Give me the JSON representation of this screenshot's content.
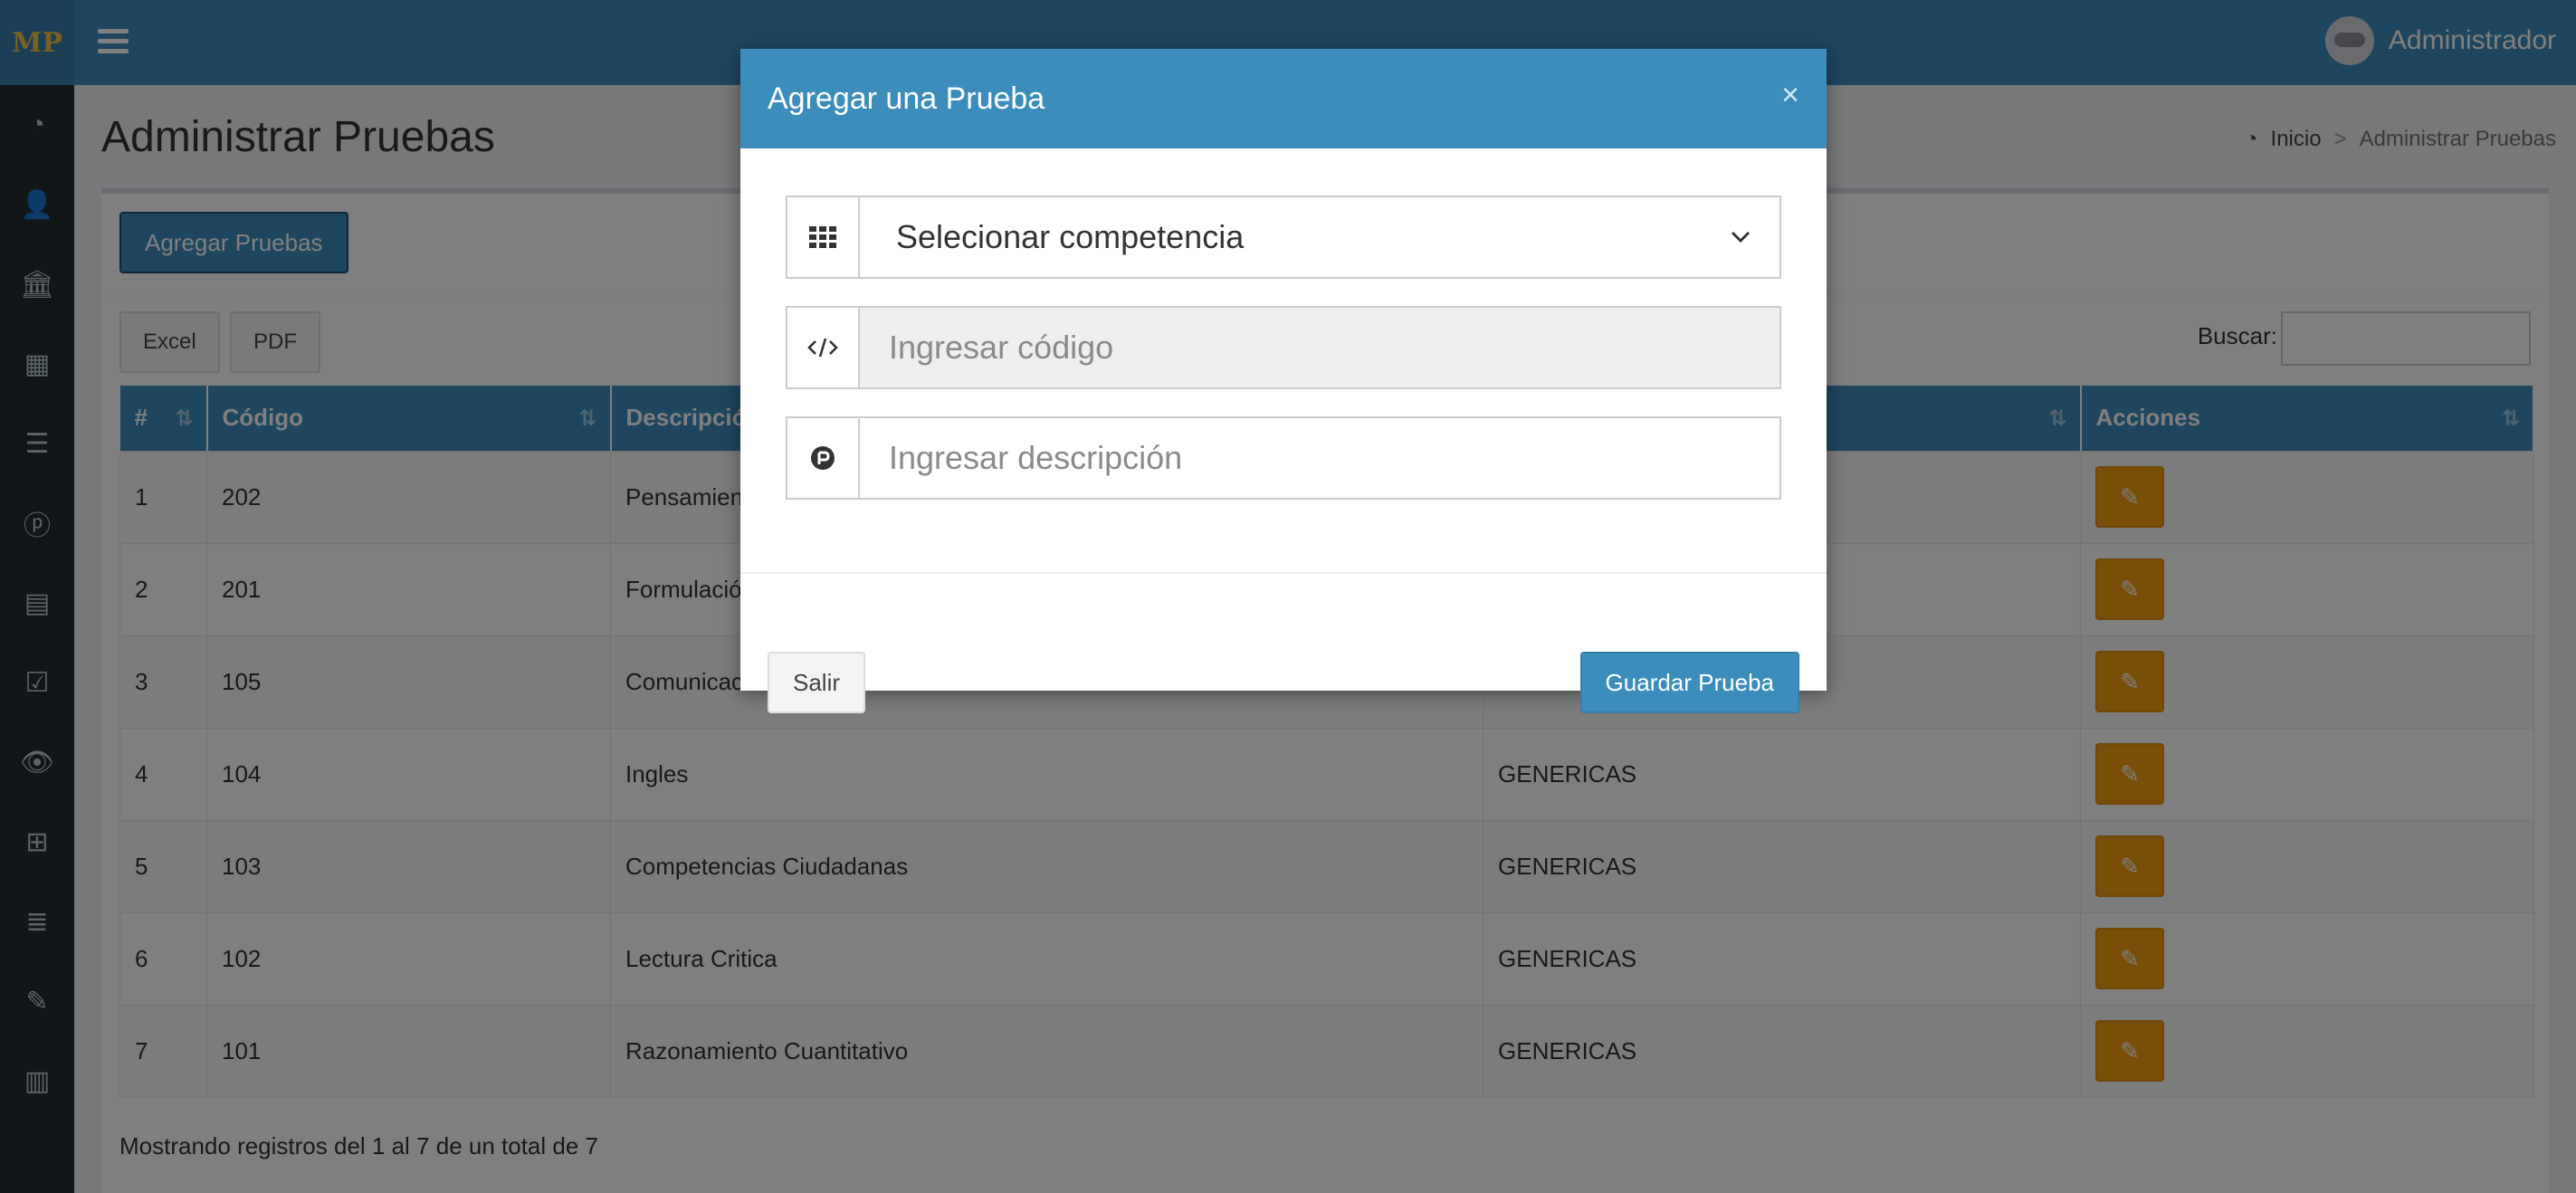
{
  "app": {
    "logo_text": "MP",
    "user_name": "Administrador"
  },
  "sidebar": {
    "items": [
      {
        "icon": "dashboard-icon",
        "glyph": "◔"
      },
      {
        "icon": "user-icon",
        "glyph": "👤"
      },
      {
        "icon": "bank-icon",
        "glyph": "🏛"
      },
      {
        "icon": "grid-icon",
        "glyph": "▦"
      },
      {
        "icon": "list-icon",
        "glyph": "☰"
      },
      {
        "icon": "product-hunt-icon",
        "glyph": "ⓟ"
      },
      {
        "icon": "newspaper-icon",
        "glyph": "▤"
      },
      {
        "icon": "check-square-icon",
        "glyph": "☑"
      },
      {
        "icon": "eye-icon",
        "glyph": "👁"
      },
      {
        "icon": "sitemap-icon",
        "glyph": "⊞"
      },
      {
        "icon": "server-icon",
        "glyph": "≣"
      },
      {
        "icon": "pencil-icon",
        "glyph": "✎"
      },
      {
        "icon": "book-icon",
        "glyph": "▥"
      }
    ]
  },
  "page": {
    "title": "Administrar Pruebas",
    "breadcrumb_home": "Inicio",
    "breadcrumb_current": "Administrar Pruebas"
  },
  "toolbar": {
    "add_label": "Agregar Pruebas",
    "excel_label": "Excel",
    "pdf_label": "PDF",
    "search_label": "Buscar:"
  },
  "table": {
    "headers": [
      "#",
      "Código",
      "Descripción",
      "",
      "Acciones"
    ],
    "rows": [
      [
        "1",
        "202",
        "Pensamiento",
        ""
      ],
      [
        "2",
        "201",
        "Formulación",
        ""
      ],
      [
        "3",
        "105",
        "Comunicación",
        ""
      ],
      [
        "4",
        "104",
        "Ingles",
        "GENERICAS"
      ],
      [
        "5",
        "103",
        "Competencias Ciudadanas",
        "GENERICAS"
      ],
      [
        "6",
        "102",
        "Lectura Critica",
        "GENERICAS"
      ],
      [
        "7",
        "101",
        "Razonamiento Cuantitativo",
        "GENERICAS"
      ]
    ],
    "info": "Mostrando registros del 1 al 7 de un total de 7"
  },
  "modal": {
    "title": "Agregar una Prueba",
    "close": "×",
    "select_value": "Selecionar competencia",
    "code_placeholder": "Ingresar código",
    "description_placeholder": "Ingresar descripción",
    "cancel_label": "Salir",
    "save_label": "Guardar Prueba"
  },
  "colors": {
    "primary": "#3c8dbc",
    "sidebar": "#222d32",
    "warning": "#f39c12"
  }
}
